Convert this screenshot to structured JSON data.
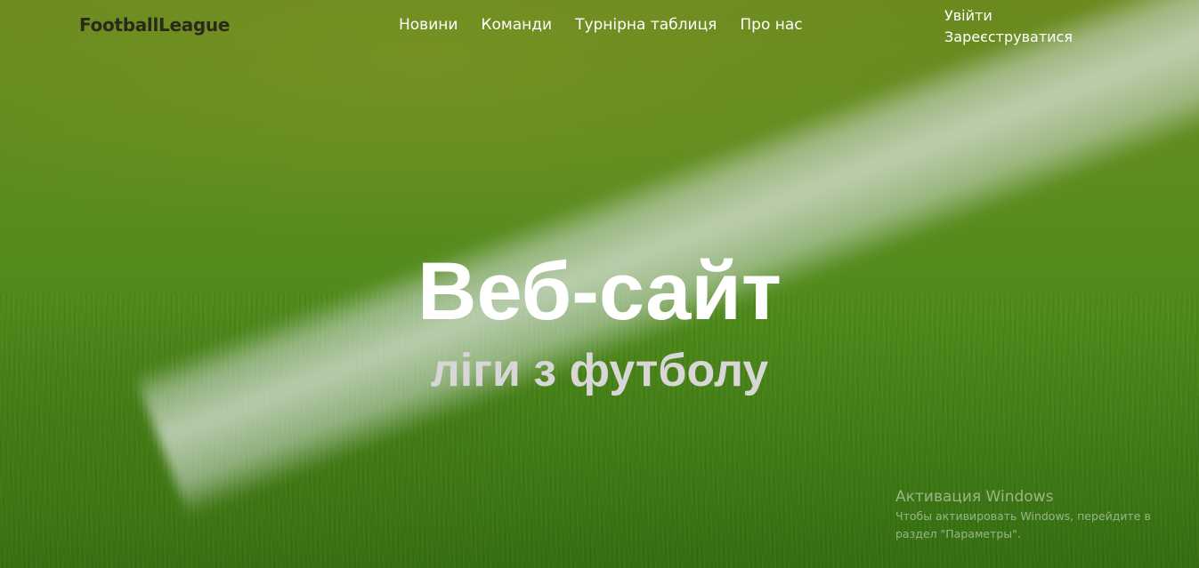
{
  "header": {
    "logo": "FootballLeague",
    "nav": [
      {
        "label": "Новини"
      },
      {
        "label": "Команди"
      },
      {
        "label": "Турнірна таблиця"
      },
      {
        "label": "Про нас"
      }
    ],
    "auth": {
      "login": "Увійти",
      "register": "Зареєструватися"
    }
  },
  "hero": {
    "title": "Веб-сайт",
    "subtitle": "ліги з футболу",
    "background": "football-pitch-grass"
  },
  "watermark": {
    "title": "Активация Windows",
    "text": "Чтобы активировать Windows, перейдите в раздел \"Параметры\"."
  },
  "colors": {
    "logo": "#2a2a1a",
    "nav_text": "#ffffff",
    "title": "#ffffff",
    "subtitle": "#d8d6d6"
  }
}
